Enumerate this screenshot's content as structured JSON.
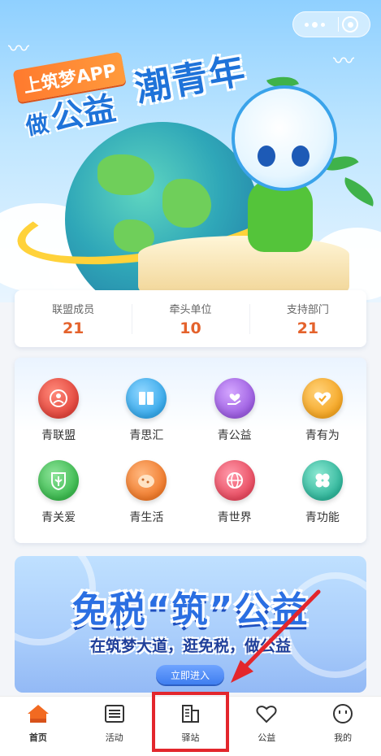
{
  "hero": {
    "tag": "上筑梦APP",
    "line2_small": "做",
    "line2_big": "公益",
    "slogan": "潮青年"
  },
  "capsule": {
    "more_icon": "more-dots-icon",
    "close_icon": "target-icon"
  },
  "stats": [
    {
      "label": "联盟成员",
      "value": "21"
    },
    {
      "label": "牵头单位",
      "value": "10"
    },
    {
      "label": "支持部门",
      "value": "21"
    }
  ],
  "menu": [
    {
      "label": "青联盟",
      "icon": "network-icon",
      "color": "#e2453c"
    },
    {
      "label": "青思汇",
      "icon": "book-icon",
      "color": "#36a8ea"
    },
    {
      "label": "青公益",
      "icon": "heart-hand-icon",
      "color": "#9b5ce0"
    },
    {
      "label": "青有为",
      "icon": "heart-check-icon",
      "color": "#f5a623"
    },
    {
      "label": "青关爱",
      "icon": "tree-icon",
      "color": "#3bb94e"
    },
    {
      "label": "青生活",
      "icon": "bread-icon",
      "color": "#f07a2a"
    },
    {
      "label": "青世界",
      "icon": "globe-icon",
      "color": "#e84a5f"
    },
    {
      "label": "青功能",
      "icon": "clover-icon",
      "color": "#2fb59a"
    }
  ],
  "banner": {
    "title": "免税“筑”公益",
    "subtitle": "在筑梦大道，逛免税，做公益",
    "button": "立即进入"
  },
  "tabbar": [
    {
      "label": "首页",
      "icon": "home-icon",
      "active": true
    },
    {
      "label": "活动",
      "icon": "list-icon",
      "active": false
    },
    {
      "label": "驿站",
      "icon": "building-icon",
      "active": false
    },
    {
      "label": "公益",
      "icon": "heart-outline-icon",
      "active": false
    },
    {
      "label": "我的",
      "icon": "smiley-icon",
      "active": false
    }
  ],
  "colors": {
    "accent": "#e4622c",
    "highlight": "#e3262c",
    "home_active": "#f26a21"
  }
}
